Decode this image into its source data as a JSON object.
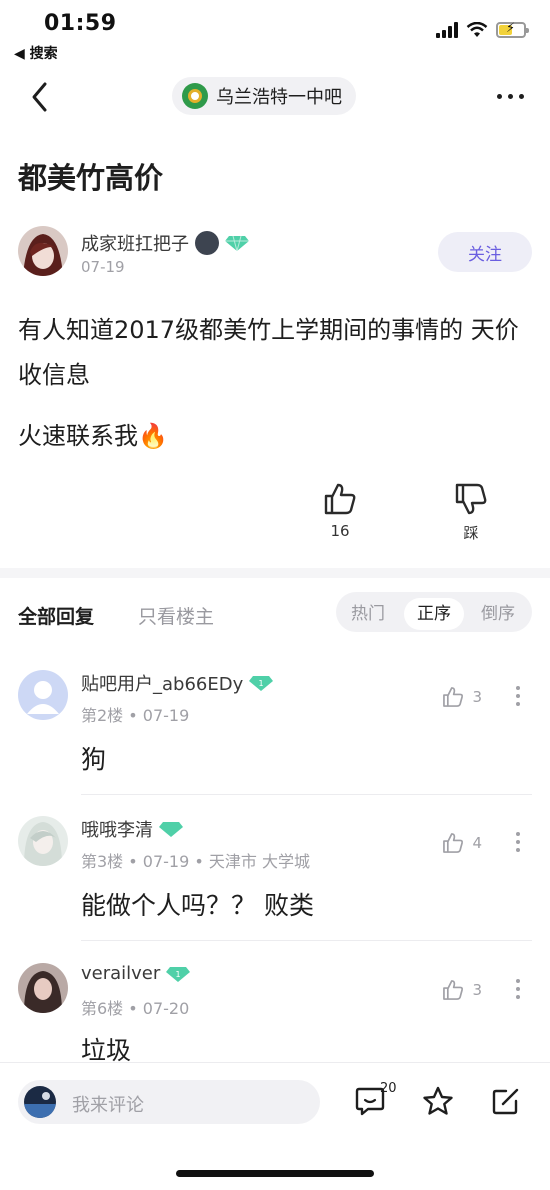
{
  "status_bar": {
    "time": "01:59",
    "back_app": "◀ 搜索"
  },
  "nav": {
    "forum_name": "乌兰浩特一中吧"
  },
  "post": {
    "title": "都美竹高价",
    "author": {
      "name": "成家班扛把子",
      "date": "07-19",
      "follow_label": "关注"
    },
    "body": [
      "有人知道2017级都美竹上学期间的事情的 天价收信息",
      "火速联系我🔥"
    ],
    "like_count": "16",
    "dislike_label": "踩"
  },
  "tabs": {
    "all_replies": "全部回复",
    "only_op": "只看楼主",
    "sort": [
      "热门",
      "正序",
      "倒序"
    ],
    "sort_selected": "正序"
  },
  "replies": [
    {
      "name": "贴吧用户_ab66EDy",
      "meta": "第2楼 • 07-19",
      "likes": "3",
      "text": "狗"
    },
    {
      "name": "哦哦李清",
      "meta": "第3楼 • 07-19 • 天津市 大学城",
      "likes": "4",
      "text": "能做个人吗？？ 败类"
    },
    {
      "name": "verailver",
      "meta": "第6楼 • 07-20",
      "likes": "3",
      "text": "垃圾"
    }
  ],
  "bottom_bar": {
    "comment_placeholder": "我来评论",
    "comment_count": "20"
  },
  "colors": {
    "accent": "#6a5ee0",
    "follow_bg": "#eeeef7",
    "gem": "#4fd0a8",
    "muted": "#a0a0a6"
  }
}
